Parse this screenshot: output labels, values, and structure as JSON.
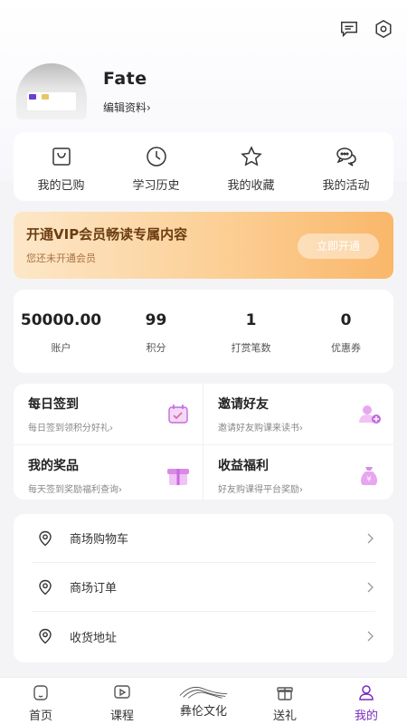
{
  "colors": {
    "accent": "#7a2bbf",
    "vip_text": "#6b3d12",
    "bg": "#f4f4f6"
  },
  "topbar": {
    "icons": [
      "message-icon",
      "settings-icon"
    ]
  },
  "profile": {
    "name": "Fate",
    "edit_label": "编辑资料›"
  },
  "quick_actions": [
    {
      "label": "我的已购",
      "icon": "bag-icon"
    },
    {
      "label": "学习历史",
      "icon": "clock-icon"
    },
    {
      "label": "我的收藏",
      "icon": "star-icon"
    },
    {
      "label": "我的活动",
      "icon": "chat-icon"
    }
  ],
  "vip": {
    "title": "开通VIP会员畅读专属内容",
    "subtitle": "您还未开通会员",
    "button": "立即开通"
  },
  "stats": [
    {
      "value": "50000.00",
      "label": "账户"
    },
    {
      "value": "99",
      "label": "积分"
    },
    {
      "value": "1",
      "label": "打赏笔数"
    },
    {
      "value": "0",
      "label": "优惠券"
    }
  ],
  "features": [
    {
      "title": "每日签到",
      "desc": "每日签到领积分好礼›",
      "icon": "calendar-icon"
    },
    {
      "title": "邀请好友",
      "desc": "邀请好友购课来读书›",
      "icon": "add-user-icon"
    },
    {
      "title": "我的奖品",
      "desc": "每天签到奖励福利查询›",
      "icon": "gift-icon"
    },
    {
      "title": "收益福利",
      "desc": "好友购课得平台奖励›",
      "icon": "money-bag-icon"
    }
  ],
  "menu": [
    {
      "label": "商场购物车",
      "icon": "location-icon"
    },
    {
      "label": "商场订单",
      "icon": "location-icon"
    },
    {
      "label": "收货地址",
      "icon": "location-icon"
    }
  ],
  "tabs": [
    {
      "label": "首页",
      "icon": "home-icon"
    },
    {
      "label": "课程",
      "icon": "video-icon"
    },
    {
      "label": "彝伦文化",
      "icon": "mountain-logo-icon"
    },
    {
      "label": "送礼",
      "icon": "gift-icon"
    },
    {
      "label": "我的",
      "icon": "user-icon",
      "active": true
    }
  ]
}
